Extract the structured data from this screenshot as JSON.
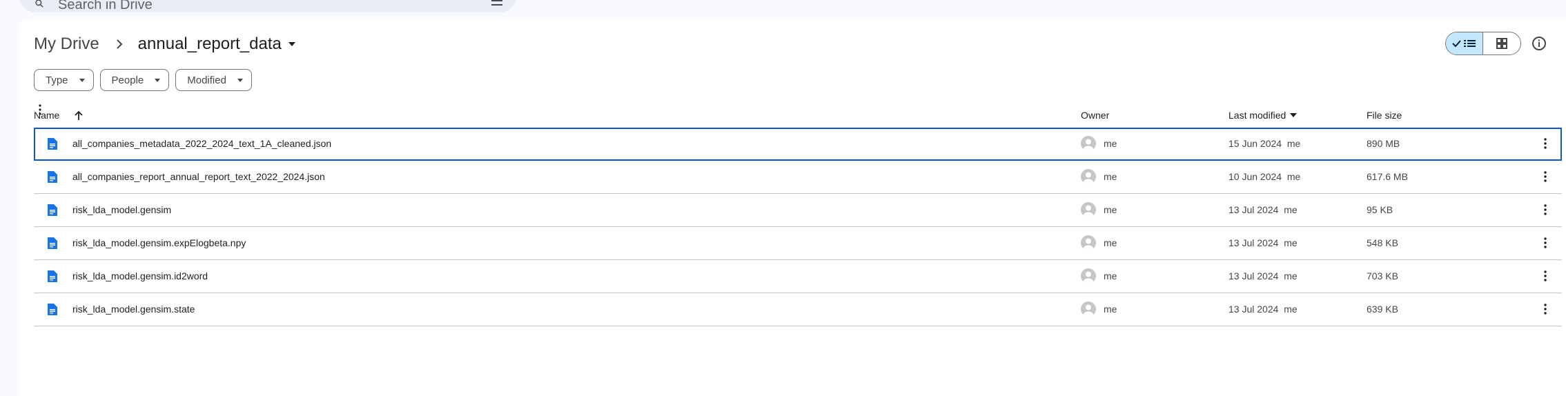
{
  "search": {
    "placeholder": "Search in Drive"
  },
  "breadcrumb": {
    "root": "My Drive",
    "current": "annual_report_data"
  },
  "filters": [
    {
      "label": "Type"
    },
    {
      "label": "People"
    },
    {
      "label": "Modified"
    }
  ],
  "table": {
    "headers": {
      "name": "Name",
      "owner": "Owner",
      "last_modified": "Last modified",
      "file_size": "File size"
    },
    "rows": [
      {
        "name": "all_companies_metadata_2022_2024_text_1A_cleaned.json",
        "owner": "me",
        "modified": "15 Jun 2024",
        "modified_by": "me",
        "size": "890 MB",
        "selected": true
      },
      {
        "name": "all_companies_report_annual_report_text_2022_2024.json",
        "owner": "me",
        "modified": "10 Jun 2024",
        "modified_by": "me",
        "size": "617.6 MB"
      },
      {
        "name": "risk_lda_model.gensim",
        "owner": "me",
        "modified": "13 Jul 2024",
        "modified_by": "me",
        "size": "95 KB"
      },
      {
        "name": "risk_lda_model.gensim.expElogbeta.npy",
        "owner": "me",
        "modified": "13 Jul 2024",
        "modified_by": "me",
        "size": "548 KB"
      },
      {
        "name": "risk_lda_model.gensim.id2word",
        "owner": "me",
        "modified": "13 Jul 2024",
        "modified_by": "me",
        "size": "703 KB"
      },
      {
        "name": "risk_lda_model.gensim.state",
        "owner": "me",
        "modified": "13 Jul 2024",
        "modified_by": "me",
        "size": "639 KB"
      }
    ]
  },
  "colors": {
    "accent": "#0b57d0",
    "file_icon": "#1a73e8",
    "toggle_active": "#c2e7ff"
  },
  "icons": [
    "search-icon",
    "tune-icon",
    "chevron-right-icon",
    "caret-down-icon",
    "check-icon",
    "list-view-icon",
    "grid-view-icon",
    "info-icon",
    "arrow-up-icon",
    "doc-icon",
    "avatar-icon",
    "share-icon",
    "download-icon",
    "rename-icon",
    "star-icon",
    "more-vert-icon"
  ]
}
